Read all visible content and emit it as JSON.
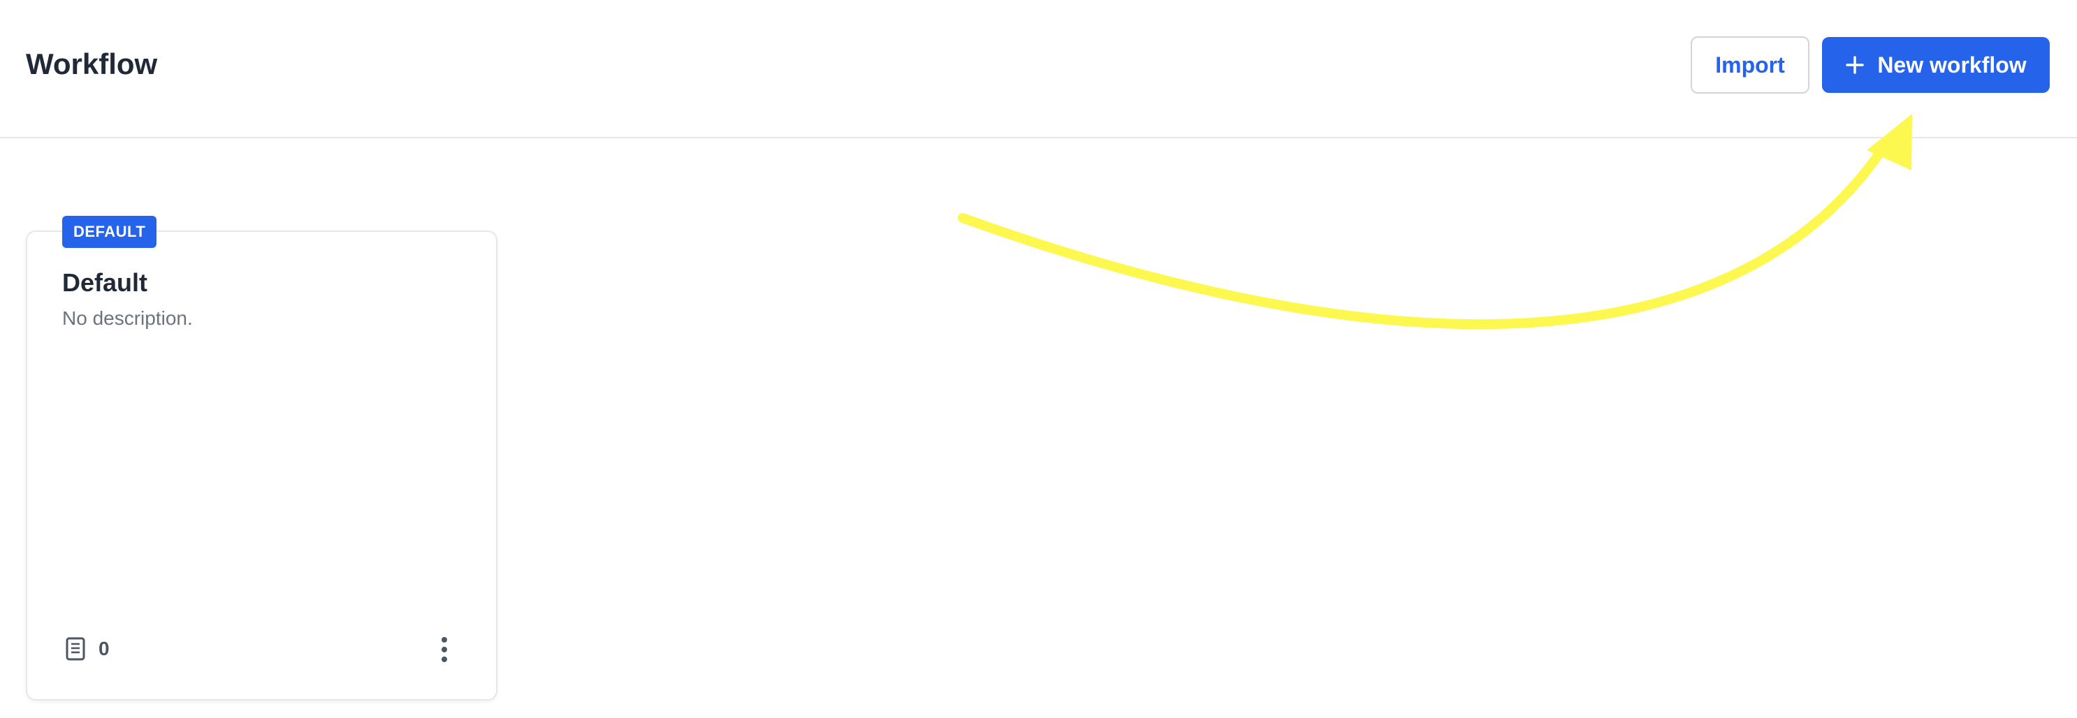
{
  "header": {
    "title": "Workflow",
    "import_label": "Import",
    "new_workflow_label": "New workflow"
  },
  "card": {
    "badge": "DEFAULT",
    "title": "Default",
    "description": "No description.",
    "doc_count": "0"
  },
  "icons": {
    "plus": "plus-icon",
    "document": "document-icon",
    "more": "more-vertical-icon",
    "annotation_arrow": "curved-arrow-icon"
  },
  "colors": {
    "primary": "#2563eb",
    "arrow": "#fdf84f",
    "title_text": "#1f2937",
    "muted_text": "#6b7280",
    "border": "#e5e7eb"
  }
}
